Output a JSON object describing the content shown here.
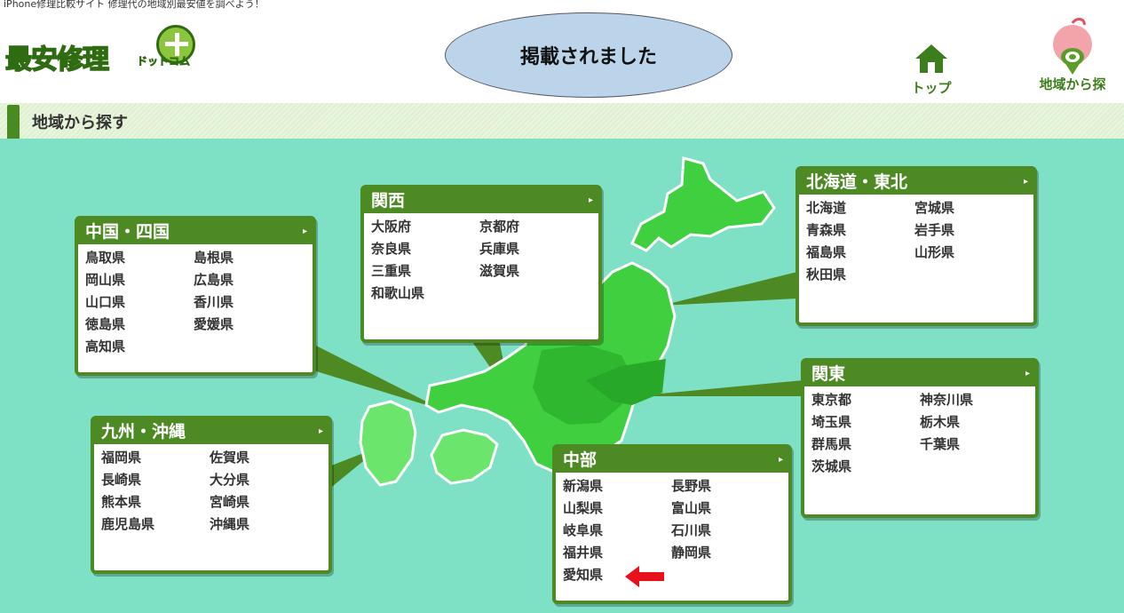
{
  "header": {
    "tagline": "iPhone修理比較サイト 修理代の地域別最安値を調べよう！",
    "logo_text": "最安修理",
    "logo_sub": "ドットコム",
    "notice": "掲載されました",
    "nav": [
      {
        "label": "トップ",
        "icon": "home-icon"
      },
      {
        "label": "地域から探",
        "icon": "apple-pin-icon"
      }
    ]
  },
  "section": {
    "title": "地域から探す"
  },
  "regions": [
    {
      "id": "chugoku-shikoku",
      "name": "中国・四国",
      "prefectures": [
        "鳥取県",
        "島根県",
        "岡山県",
        "広島県",
        "山口県",
        "香川県",
        "徳島県",
        "愛媛県",
        "高知県"
      ]
    },
    {
      "id": "kansai",
      "name": "関西",
      "prefectures": [
        "大阪府",
        "京都府",
        "奈良県",
        "兵庫県",
        "三重県",
        "滋賀県",
        "和歌山県"
      ]
    },
    {
      "id": "hokkaido-tohoku",
      "name": "北海道・東北",
      "prefectures": [
        "北海道",
        "宮城県",
        "青森県",
        "岩手県",
        "福島県",
        "山形県",
        "秋田県"
      ]
    },
    {
      "id": "kanto",
      "name": "関東",
      "prefectures": [
        "東京都",
        "神奈川県",
        "埼玉県",
        "栃木県",
        "群馬県",
        "千葉県",
        "茨城県"
      ]
    },
    {
      "id": "kyushu-okinawa",
      "name": "九州・沖縄",
      "prefectures": [
        "福岡県",
        "佐賀県",
        "長崎県",
        "大分県",
        "熊本県",
        "宮崎県",
        "鹿児島県",
        "沖縄県"
      ]
    },
    {
      "id": "chubu",
      "name": "中部",
      "prefectures": [
        "新潟県",
        "長野県",
        "山梨県",
        "富山県",
        "岐阜県",
        "石川県",
        "福井県",
        "静岡県",
        "愛知県"
      ]
    }
  ],
  "colors": {
    "map_bg": "#7ee0c4",
    "box_green": "#4d8a24",
    "land_green": "#3fcf3f",
    "highlight_arrow": "#e8101a"
  }
}
